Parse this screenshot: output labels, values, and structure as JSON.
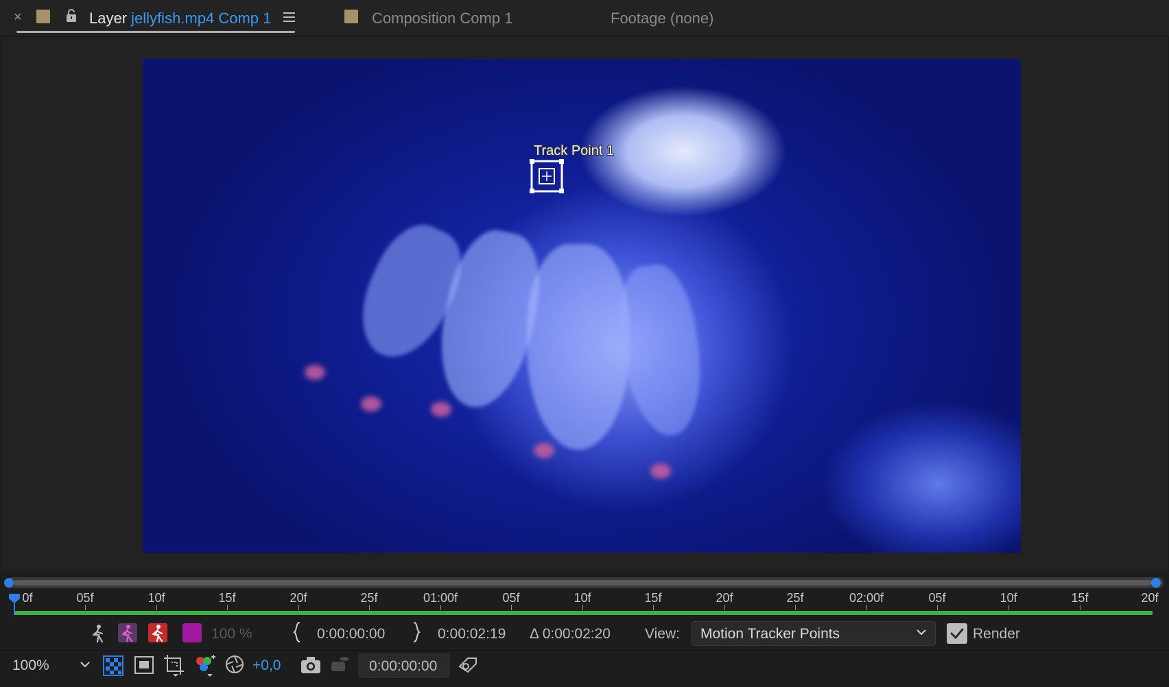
{
  "tabs": {
    "close_glyph": "×",
    "layer_tab": {
      "prefix": "Layer",
      "link": "jellyfish.mp4 Comp 1"
    },
    "composition_tab": {
      "label": "Composition Comp 1"
    },
    "footage_tab": {
      "label": "Footage (none)"
    },
    "swatch_color": "#a8906a"
  },
  "viewer": {
    "track_point_label": "Track Point 1"
  },
  "timeline": {
    "labels": [
      "0f",
      "05f",
      "10f",
      "15f",
      "20f",
      "25f",
      "01:00f",
      "05f",
      "10f",
      "15f",
      "20f",
      "25f",
      "02:00f",
      "05f",
      "10f",
      "15f",
      "20f"
    ],
    "range_color": "#3cb043",
    "playhead_color": "#2f7ee6"
  },
  "controls": {
    "opacity": "100 %",
    "in_time": "0:00:00:00",
    "out_time": "0:00:02:19",
    "duration": "Δ 0:00:02:20",
    "view_label": "View:",
    "view_value": "Motion Tracker Points",
    "render_label": "Render",
    "render_checked": true,
    "zoom": "100%",
    "exposure": "+0,0",
    "current_time": "0:00:00:00"
  }
}
